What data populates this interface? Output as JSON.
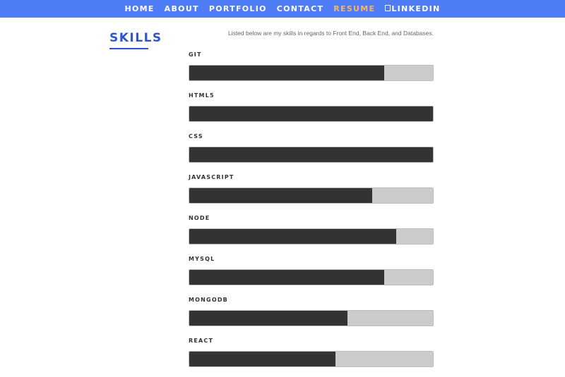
{
  "nav": {
    "items": [
      {
        "label": "HOME"
      },
      {
        "label": "ABOUT"
      },
      {
        "label": "PORTFOLIO"
      },
      {
        "label": "CONTACT"
      },
      {
        "label": "RESUME"
      },
      {
        "label": "LINKEDIN"
      }
    ],
    "active": "RESUME",
    "accent_color": "#4f7cf7",
    "active_color": "#f5b562"
  },
  "section": {
    "heading": "SKILLS",
    "heading_color": "#2b56d6",
    "intro": "Listed below are my skills in regards to Front End, Back End, and Databases."
  },
  "skills": [
    {
      "name": "GIT",
      "level": 0.8
    },
    {
      "name": "HTML5",
      "level": 1.0
    },
    {
      "name": "CSS",
      "level": 1.0
    },
    {
      "name": "JAVASCRIPT",
      "level": 0.75
    },
    {
      "name": "NODE",
      "level": 0.85
    },
    {
      "name": "MYSQL",
      "level": 0.8
    },
    {
      "name": "MONGODB",
      "level": 0.65
    },
    {
      "name": "REACT",
      "level": 0.6
    }
  ]
}
